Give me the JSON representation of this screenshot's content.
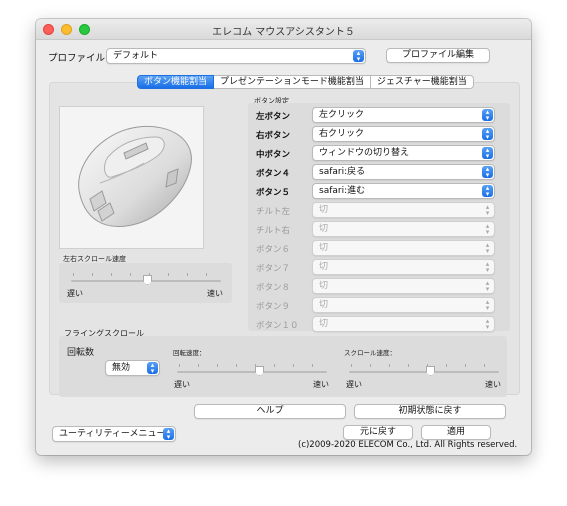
{
  "window": {
    "title": "エレコム マウスアシスタント５"
  },
  "profile": {
    "label": "プロファイル：",
    "selected": "デフォルト",
    "edit_button": "プロファイル編集"
  },
  "tabs": [
    "ボタン機能割当",
    "プレゼンテーションモード機能割当",
    "ジェスチャー機能割当"
  ],
  "left_right_scroll": {
    "title": "左右スクロール速度",
    "min_label": "遅い",
    "max_label": "速い",
    "level": 0.5
  },
  "button_settings": {
    "title": "ボタン設定",
    "rows": [
      {
        "label": "左ボタン",
        "value": "左クリック",
        "enabled": true
      },
      {
        "label": "右ボタン",
        "value": "右クリック",
        "enabled": true
      },
      {
        "label": "中ボタン",
        "value": "ウィンドウの切り替え",
        "enabled": true
      },
      {
        "label": "ボタン４",
        "value": "safari:戻る",
        "enabled": true
      },
      {
        "label": "ボタン５",
        "value": "safari:進む",
        "enabled": true
      },
      {
        "label": "チルト左",
        "value": "切",
        "enabled": false
      },
      {
        "label": "チルト右",
        "value": "切",
        "enabled": false
      },
      {
        "label": "ボタン６",
        "value": "切",
        "enabled": false
      },
      {
        "label": "ボタン７",
        "value": "切",
        "enabled": false
      },
      {
        "label": "ボタン８",
        "value": "切",
        "enabled": false
      },
      {
        "label": "ボタン９",
        "value": "切",
        "enabled": false
      },
      {
        "label": "ボタン１０",
        "value": "切",
        "enabled": false
      }
    ]
  },
  "flinging": {
    "title": "フライングスクロール",
    "rotation_label": "回転数",
    "rotation_value": "無効",
    "rotation_speed_label": "回転速度：",
    "scroll_speed_label": "スクロール速度：",
    "slow": "遅い",
    "fast": "速い",
    "rotation_speed_level": 0.5,
    "scroll_speed_level": 0.5
  },
  "buttons": {
    "help": "ヘルプ",
    "reset": "初期状態に戻す",
    "revert": "元に戻す",
    "apply": "適用"
  },
  "utility_menu": "ユーティリティーメニュー",
  "copyright": "(c)2009-2020 ELECOM Co., Ltd. All Rights reserved.",
  "colors": {
    "accent": "#1a6fe6",
    "window_bg": "#ececec",
    "panel_bg": "#e4e4e4"
  }
}
